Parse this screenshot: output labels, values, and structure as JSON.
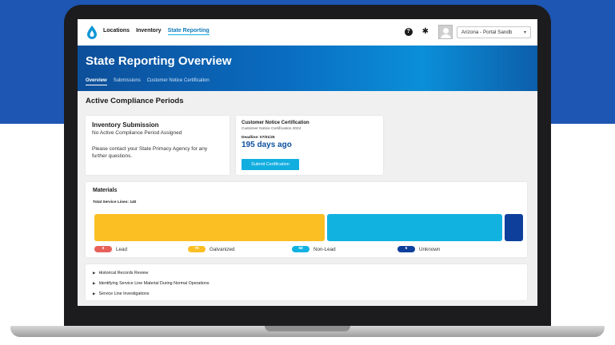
{
  "nav": {
    "links": [
      "Locations",
      "Inventory",
      "State Reporting"
    ],
    "active": "State Reporting",
    "org_select": "Arizona - Portal Sandb"
  },
  "icons": {
    "logo": "droplet-logo-icon",
    "help": "help-icon",
    "settings": "gear-icon",
    "avatar": "user-avatar-icon",
    "select_chevron": "chevron-down-icon",
    "accordion": "caret-right-icon"
  },
  "hero": {
    "title": "State Reporting Overview",
    "tabs": [
      "Overview",
      "Submissions",
      "Customer Notice Certification"
    ],
    "active_tab": "Overview"
  },
  "compliance": {
    "heading": "Active Compliance Periods",
    "inventory": {
      "title": "Inventory Submission",
      "subtitle": "No Active Compliance Period Assigned",
      "message": "Please contact your State Primacy Agency for any further questions."
    },
    "customer_notice": {
      "title": "Customer Notice Certification",
      "subtitle": "Customer Notice Certification 2024",
      "deadline": "Deadline: 07/01/25",
      "days": "195 days ago",
      "button": "Submit Certification"
    }
  },
  "materials": {
    "title": "Materials",
    "total_label": "Total Service Lines:",
    "total_value": "140",
    "categories": [
      {
        "name": "Lead",
        "count": 0,
        "color": "#e8605a"
      },
      {
        "name": "Galvanized",
        "count": 76,
        "color": "#fbbf24"
      },
      {
        "name": "Non-Lead",
        "count": 58,
        "color": "#12b2e0"
      },
      {
        "name": "Unknown",
        "count": 6,
        "color": "#0d3f9b"
      }
    ]
  },
  "accordion": [
    "Historical Records Review",
    "Identifying Service Line Material During Normal Operations",
    "Service Line Investigations"
  ]
}
